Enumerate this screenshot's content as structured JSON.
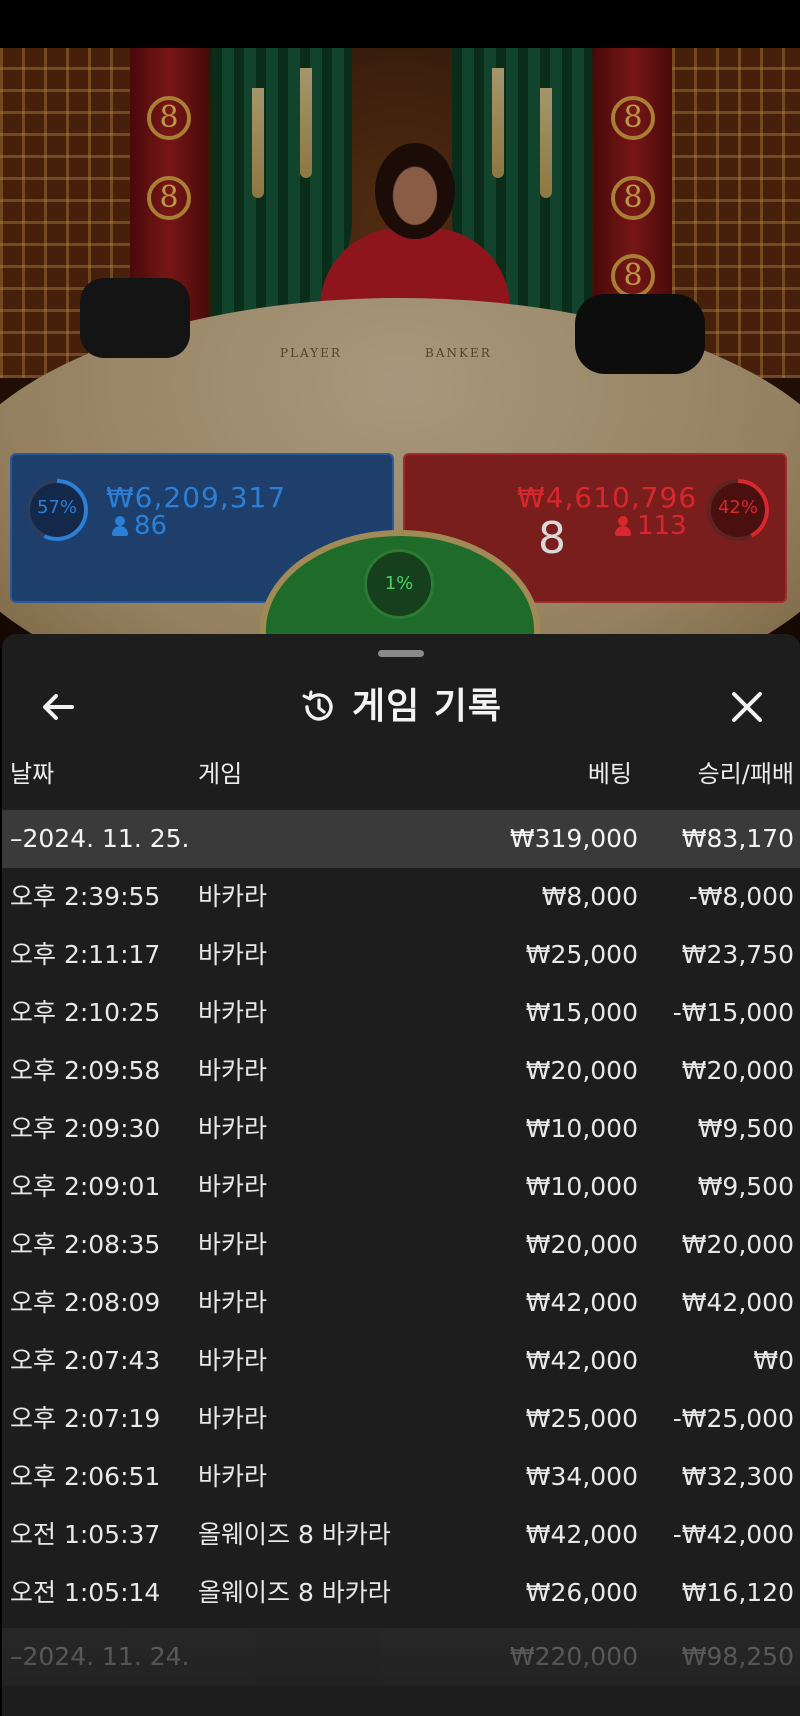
{
  "scene": {
    "table_labels": {
      "player": "PLAYER",
      "banker": "BANKER"
    },
    "player_panel": {
      "percent": "57%",
      "amount": "₩6,209,317",
      "players": "86",
      "color": "#2c7fd6"
    },
    "banker_panel": {
      "percent": "42%",
      "amount": "₩4,610,796",
      "players": "113",
      "card_score": "8",
      "color": "#d8272d"
    },
    "tie": {
      "percent": "1%",
      "color": "#3fcf5d"
    },
    "decor_digit": "8"
  },
  "history": {
    "title": "게임 기록",
    "icons": {
      "back": "arrow-left-icon",
      "title": "history-icon",
      "close": "close-icon"
    },
    "columns": {
      "date": "날짜",
      "game": "게임",
      "bet": "베팅",
      "win_loss": "승리/패배"
    },
    "groups": [
      {
        "date": "–2024. 11. 25.",
        "total_bet": "₩319,000",
        "total_win_loss": "₩83,170",
        "rows": [
          {
            "time": "오후 2:39:55",
            "game": "바카라",
            "bet": "₩8,000",
            "win_loss": "-₩8,000"
          },
          {
            "time": "오후 2:11:17",
            "game": "바카라",
            "bet": "₩25,000",
            "win_loss": "₩23,750"
          },
          {
            "time": "오후 2:10:25",
            "game": "바카라",
            "bet": "₩15,000",
            "win_loss": "-₩15,000"
          },
          {
            "time": "오후 2:09:58",
            "game": "바카라",
            "bet": "₩20,000",
            "win_loss": "₩20,000"
          },
          {
            "time": "오후 2:09:30",
            "game": "바카라",
            "bet": "₩10,000",
            "win_loss": "₩9,500"
          },
          {
            "time": "오후 2:09:01",
            "game": "바카라",
            "bet": "₩10,000",
            "win_loss": "₩9,500"
          },
          {
            "time": "오후 2:08:35",
            "game": "바카라",
            "bet": "₩20,000",
            "win_loss": "₩20,000"
          },
          {
            "time": "오후 2:08:09",
            "game": "바카라",
            "bet": "₩42,000",
            "win_loss": "₩42,000"
          },
          {
            "time": "오후 2:07:43",
            "game": "바카라",
            "bet": "₩42,000",
            "win_loss": "₩0"
          },
          {
            "time": "오후 2:07:19",
            "game": "바카라",
            "bet": "₩25,000",
            "win_loss": "-₩25,000"
          },
          {
            "time": "오후 2:06:51",
            "game": "바카라",
            "bet": "₩34,000",
            "win_loss": "₩32,300"
          },
          {
            "time": "오전 1:05:37",
            "game": "올웨이즈 8 바카라",
            "bet": "₩42,000",
            "win_loss": "-₩42,000"
          },
          {
            "time": "오전 1:05:14",
            "game": "올웨이즈 8 바카라",
            "bet": "₩26,000",
            "win_loss": "₩16,120"
          }
        ]
      },
      {
        "date": "–2024. 11. 24.",
        "total_bet": "₩220,000",
        "total_win_loss": "₩98,250",
        "rows": []
      }
    ]
  }
}
